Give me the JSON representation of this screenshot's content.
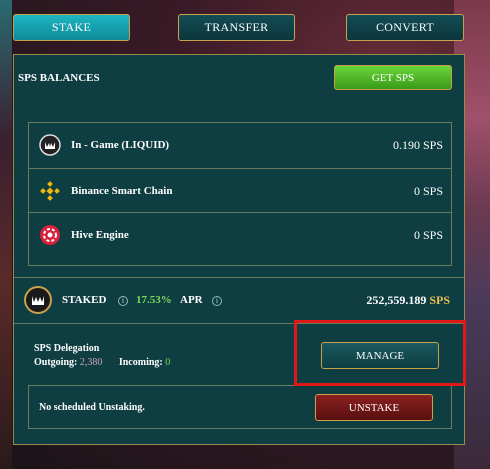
{
  "tabs": [
    {
      "label": "STAKE",
      "active": true
    },
    {
      "label": "TRANSFER",
      "active": false
    },
    {
      "label": "CONVERT",
      "active": false
    }
  ],
  "balances": {
    "title": "SPS BALANCES",
    "get_sps_label": "GET SPS",
    "rows": [
      {
        "label": "In - Game (LIQUID)",
        "value": "0.190 SPS",
        "icon": "splinterlands-icon"
      },
      {
        "label": "Binance Smart Chain",
        "value": "0 SPS",
        "icon": "binance-icon"
      },
      {
        "label": "Hive Engine",
        "value": "0 SPS",
        "icon": "hive-engine-icon"
      }
    ]
  },
  "staked": {
    "label": "STAKED",
    "apr_value": "17.53%",
    "apr_label": "APR",
    "amount": "252,559.189",
    "unit": "SPS"
  },
  "delegation": {
    "title": "SPS Delegation",
    "outgoing_label": "Outgoing:",
    "outgoing_value": "2,380",
    "incoming_label": "Incoming:",
    "incoming_value": "0",
    "manage_label": "MANAGE"
  },
  "unstake": {
    "status": "No scheduled Unstaking.",
    "button_label": "UNSTAKE"
  },
  "colors": {
    "panel_bg": "#0e3d42",
    "accent_gold": "#c8a24a",
    "apr_green": "#7ed957",
    "highlight_red": "#e01818"
  }
}
